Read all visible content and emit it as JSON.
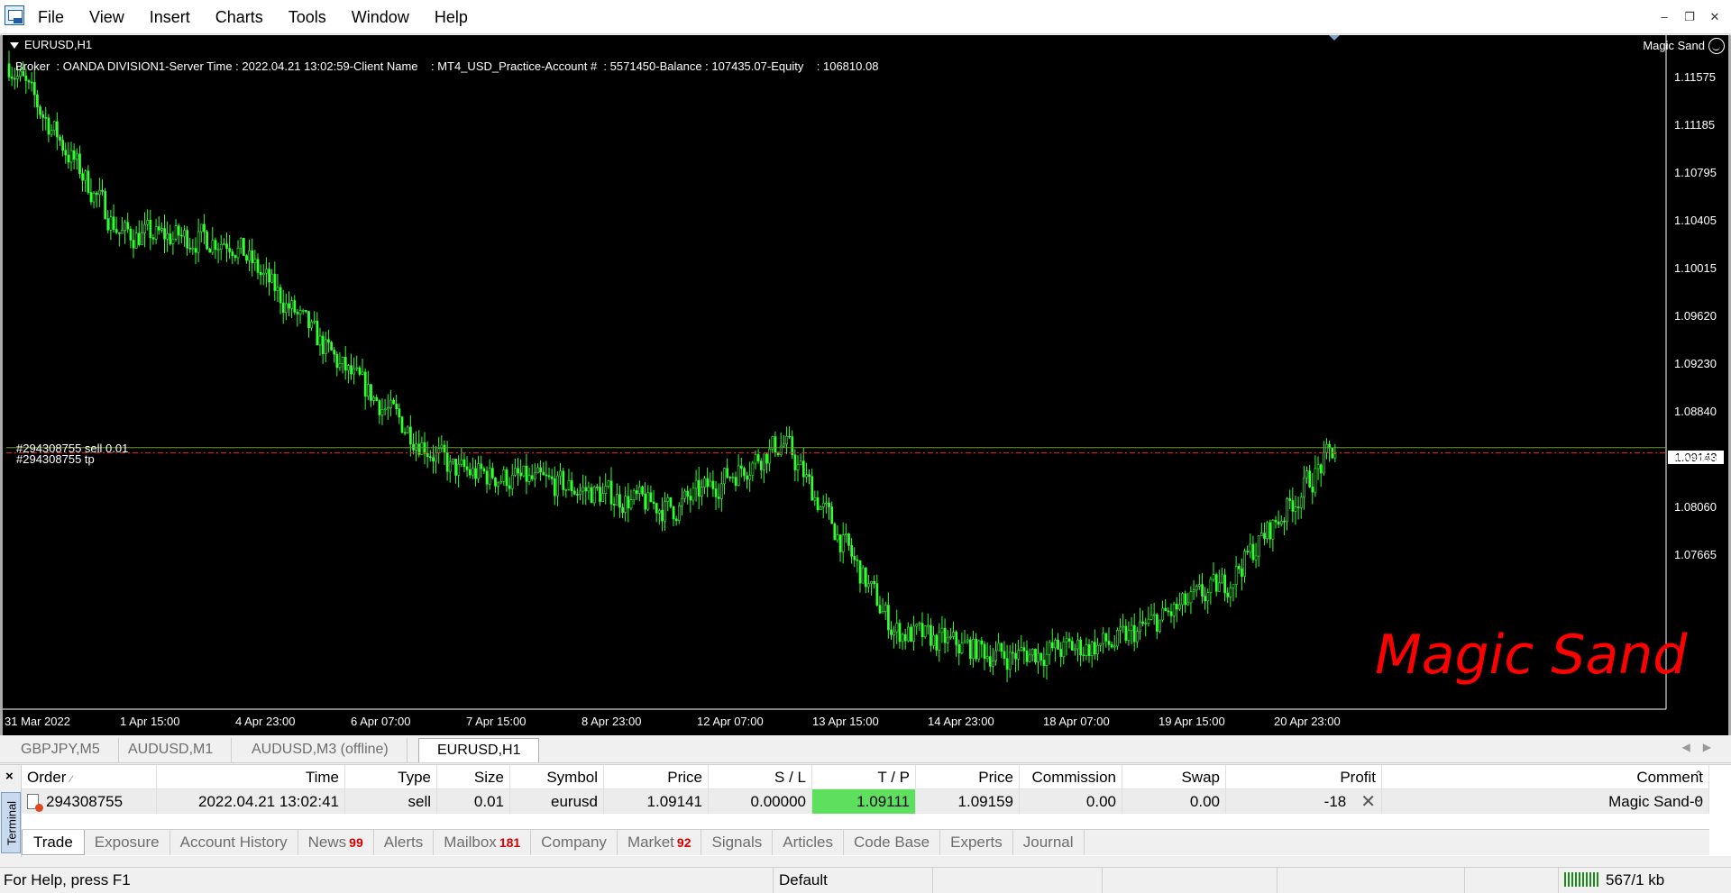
{
  "menu": {
    "items": [
      "File",
      "View",
      "Insert",
      "Charts",
      "Tools",
      "Window",
      "Help"
    ]
  },
  "window_controls": {
    "minimize": "–",
    "restore": "❐",
    "close": "✕"
  },
  "chart": {
    "title": "EURUSD,H1",
    "info_line": "Broker  : OANDA DIVISION1-Server Time : 2022.04.21 13:02:59-Client Name    : MT4_USD_Practice-Account #  : 5571450-Balance : 107435.07-Equity    : 106810.08",
    "expert_name": "Magic Sand",
    "order_labels": [
      "#294308755 sell 0.01",
      "#294308755 tp"
    ],
    "watermark": "Magic Sand",
    "current_price": "1.09143",
    "candle_color": "#32ff32",
    "price_axis": [
      "1.11575",
      "1.11185",
      "1.10795",
      "1.10405",
      "1.10015",
      "1.09620",
      "1.09230",
      "1.08840",
      "1.08450",
      "1.08060",
      "1.07665"
    ],
    "time_axis": [
      "31 Mar 2022",
      "1 Apr 15:00",
      "4 Apr 23:00",
      "6 Apr 07:00",
      "7 Apr 15:00",
      "8 Apr 23:00",
      "12 Apr 07:00",
      "13 Apr 15:00",
      "14 Apr 23:00",
      "18 Apr 07:00",
      "19 Apr 15:00",
      "20 Apr 23:00"
    ]
  },
  "chart_data": {
    "type": "line",
    "title": "EURUSD,H1",
    "xlabel": "",
    "ylabel": "",
    "categories": [
      "31 Mar 2022",
      "1 Apr 15:00",
      "4 Apr 23:00",
      "6 Apr 07:00",
      "7 Apr 15:00",
      "8 Apr 23:00",
      "12 Apr 07:00",
      "13 Apr 15:00",
      "14 Apr 23:00",
      "18 Apr 07:00",
      "19 Apr 15:00",
      "20 Apr 23:00",
      "21 Apr 13:00"
    ],
    "series": [
      {
        "values": [
          1.1158,
          1.105,
          1.1046,
          1.0965,
          1.09,
          1.089,
          1.0875,
          1.0918,
          1.0798,
          1.0782,
          1.079,
          1.0828,
          1.0914
        ]
      }
    ],
    "ylim": [
      1.075,
      1.1175
    ],
    "grid": false
  },
  "chart_tabs": [
    "GBPJPY,M5",
    "AUDUSD,M1",
    "AUDUSD,M3 (offline)",
    "EURUSD,H1"
  ],
  "terminal": {
    "label": "Terminal",
    "close": "×",
    "columns": [
      "Order",
      "Time",
      "Type",
      "Size",
      "Symbol",
      "Price",
      "S / L",
      "T / P",
      "Price",
      "Commission",
      "Swap",
      "Profit",
      "Comment"
    ],
    "rows": [
      [
        "294308755",
        "2022.04.21 13:02:41",
        "sell",
        "0.01",
        "eurusd",
        "1.09141",
        "0.00000",
        "1.09111",
        "1.09159",
        "0.00",
        "0.00",
        "-18",
        "Magic Sand-0"
      ]
    ],
    "tabs": [
      {
        "label": "Trade",
        "badge": ""
      },
      {
        "label": "Exposure",
        "badge": ""
      },
      {
        "label": "Account History",
        "badge": ""
      },
      {
        "label": "News",
        "badge": "99"
      },
      {
        "label": "Alerts",
        "badge": ""
      },
      {
        "label": "Mailbox",
        "badge": "181"
      },
      {
        "label": "Company",
        "badge": ""
      },
      {
        "label": "Market",
        "badge": "92"
      },
      {
        "label": "Signals",
        "badge": ""
      },
      {
        "label": "Articles",
        "badge": ""
      },
      {
        "label": "Code Base",
        "badge": ""
      },
      {
        "label": "Experts",
        "badge": ""
      },
      {
        "label": "Journal",
        "badge": ""
      }
    ]
  },
  "status": {
    "help": "For Help, press F1",
    "profile": "Default",
    "traffic": "567/1 kb"
  }
}
